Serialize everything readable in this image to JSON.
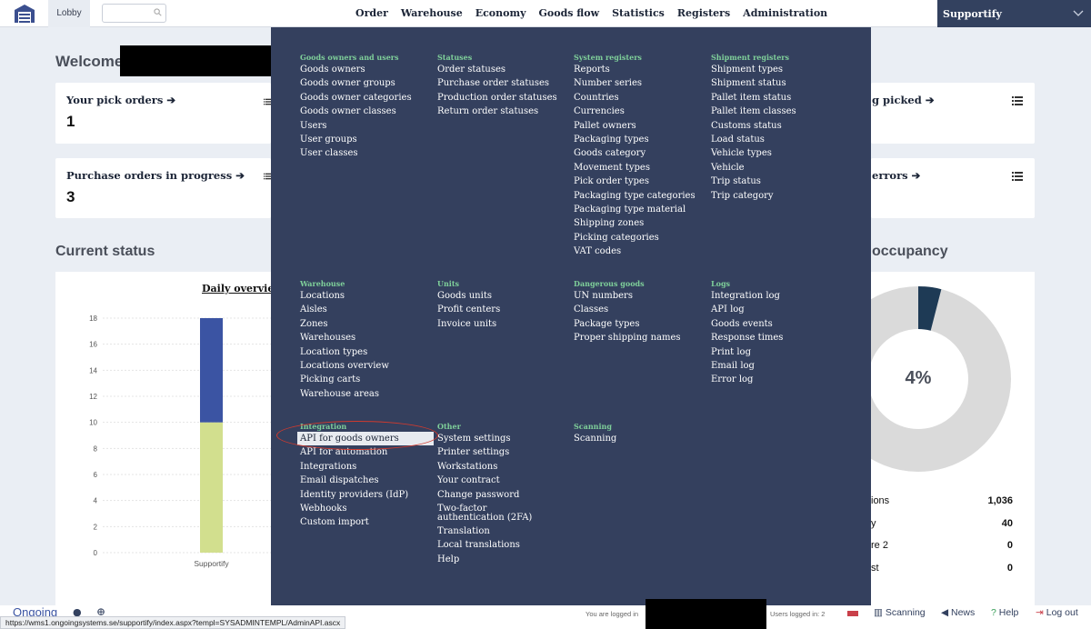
{
  "topbar": {
    "lobby": "Lobby",
    "search_placeholder": "",
    "nav": [
      "Order",
      "Warehouse",
      "Economy",
      "Goods flow",
      "Statistics",
      "Registers",
      "Administration"
    ],
    "company": "Supportify"
  },
  "dashboard": {
    "welcome": "Welcome",
    "cards": [
      {
        "title": "Your pick orders",
        "value": "1"
      },
      {
        "title": "Purchase orders in progress",
        "value": "3"
      },
      {
        "title": "g picked",
        "value": ""
      },
      {
        "title": "errors",
        "value": ""
      }
    ],
    "current_status": "Current status",
    "occupancy_title": "occupancy",
    "donut_percent": "4%",
    "donut_fraction": 0.04,
    "stats": [
      {
        "label": "ions",
        "value": "1,036"
      },
      {
        "label": "y",
        "value": "40"
      },
      {
        "label": "re 2",
        "value": "0"
      },
      {
        "label": "st",
        "value": "0"
      }
    ]
  },
  "chart_data": {
    "type": "bar",
    "title": "Daily overview",
    "categories": [
      "Supportify"
    ],
    "series": [
      {
        "values": [
          10
        ],
        "color": "#d2df8e"
      },
      {
        "values": [
          8
        ],
        "color": "#3b54a3"
      }
    ],
    "ylim": [
      0,
      18
    ],
    "yticks": [
      "0",
      "2",
      "4",
      "6",
      "8",
      "10",
      "12",
      "14",
      "16",
      "18"
    ],
    "grid": true
  },
  "menu": {
    "sections": [
      {
        "title": "Goods owners and users",
        "items": [
          "Goods owners",
          "Goods owner groups",
          "Goods owner categories",
          "Goods owner classes",
          "Users",
          "User groups",
          "User classes"
        ]
      },
      {
        "title": "Statuses",
        "items": [
          "Order statuses",
          "Purchase order statuses",
          "Production order statuses",
          "Return order statuses"
        ]
      },
      {
        "title": "System registers",
        "items": [
          "Reports",
          "Number series",
          "Countries",
          "Currencies",
          "Pallet owners",
          "Packaging types",
          "Goods category",
          "Movement types",
          "Pick order types",
          "Packaging type categories",
          "Packaging type material",
          "Shipping zones",
          "Picking categories",
          "VAT codes"
        ]
      },
      {
        "title": "Shipment registers",
        "items": [
          "Shipment types",
          "Shipment status",
          "Pallet item status",
          "Pallet item classes",
          "Customs status",
          "Load status",
          "Vehicle types",
          "Vehicle",
          "Trip status",
          "Trip category"
        ]
      },
      {
        "title": "Warehouse",
        "items": [
          "Locations",
          "Aisles",
          "Zones",
          "Warehouses",
          "Location types",
          "Locations overview",
          "Picking carts",
          "Warehouse areas"
        ]
      },
      {
        "title": "Units",
        "items": [
          "Goods units",
          "Profit centers",
          "Invoice units"
        ]
      },
      {
        "title": "Dangerous goods",
        "items": [
          "UN numbers",
          "Classes",
          "Package types",
          "Proper shipping names"
        ]
      },
      {
        "title": "Logs",
        "items": [
          "Integration log",
          "API log",
          "Goods events",
          "Response times",
          "Print log",
          "Email log",
          "Error log"
        ]
      },
      {
        "title": "Integration",
        "items": [
          "API for goods owners",
          "API for automation",
          "Integrations",
          "Email dispatches",
          "Identity providers (IdP)",
          "Webhooks",
          "Custom import"
        ]
      },
      {
        "title": "Other",
        "items": [
          "System settings",
          "Printer settings",
          "Workstations",
          "Your contract",
          "Change password",
          "Two-factor authentication (2FA)",
          "Translation",
          "Local translations",
          "Help"
        ]
      },
      {
        "title": "Scanning",
        "items": [
          "Scanning"
        ]
      }
    ]
  },
  "footer": {
    "brand": "Ongoing",
    "url": "https://wms1.ongoingsystems.se/supportify/index.aspx?templ=SYSADMINTEMPL/AdminAPI.ascx",
    "logged_in": "You are logged in",
    "users_logged": "Users logged in: 2",
    "links": [
      "Scanning",
      "News",
      "Help",
      "Log out"
    ]
  }
}
